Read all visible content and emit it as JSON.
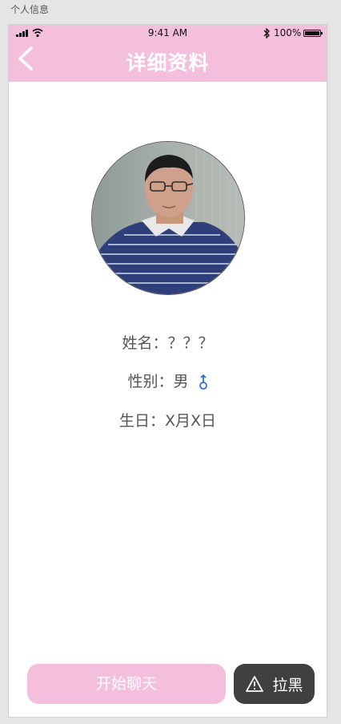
{
  "canvas": {
    "label": "个人信息"
  },
  "status_bar": {
    "time": "9:41 AM",
    "battery": "100%"
  },
  "header": {
    "title": "详细资料",
    "back_icon": "chevron-left-icon"
  },
  "profile": {
    "avatar_alt": "avatar photo",
    "name_label": "姓名：",
    "name_value": "？？？",
    "gender_label": "性别：",
    "gender_value": "男",
    "gender_icon": "male-icon",
    "birthday_label": "生日：",
    "birthday_value": "X月X日"
  },
  "actions": {
    "chat_label": "开始聊天",
    "block_label": "拉黑",
    "block_icon": "warning-icon"
  },
  "colors": {
    "header": "#f4bfdc",
    "chat_button": "#f4bfdc",
    "block_button": "#404040",
    "male_icon": "#2f6fd0"
  }
}
